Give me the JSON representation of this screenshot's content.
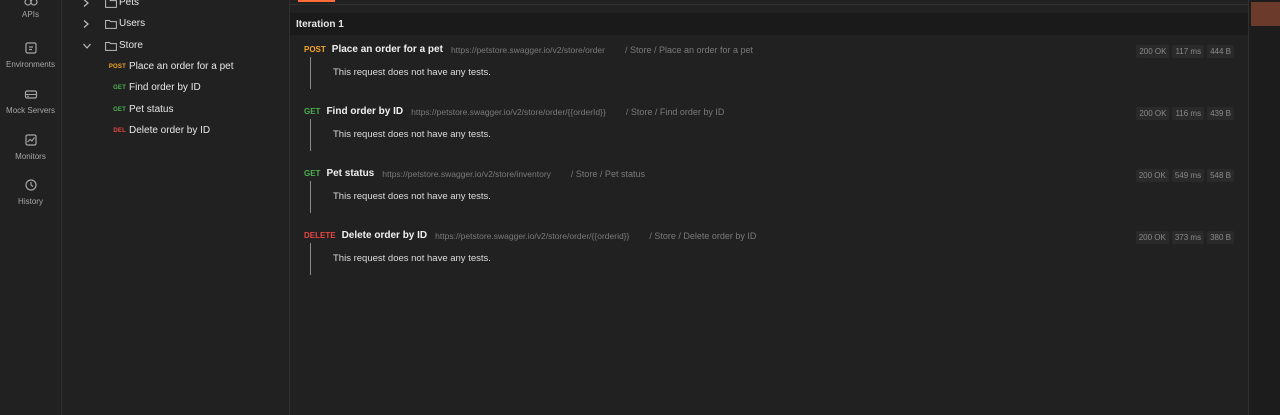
{
  "rail": {
    "items": [
      {
        "label": "APIs",
        "icon": "apis-icon"
      },
      {
        "label": "Environments",
        "icon": "environments-icon"
      },
      {
        "label": "Mock Servers",
        "icon": "mock-servers-icon"
      },
      {
        "label": "Monitors",
        "icon": "monitors-icon"
      },
      {
        "label": "History",
        "icon": "history-icon"
      }
    ]
  },
  "tree": {
    "folders": [
      {
        "name": "Pets",
        "expanded": false
      },
      {
        "name": "Users",
        "expanded": false
      },
      {
        "name": "Store",
        "expanded": true
      }
    ],
    "requests": [
      {
        "method": "POST",
        "name": "Place an order for a pet"
      },
      {
        "method": "GET",
        "name": "Find order by ID"
      },
      {
        "method": "GET",
        "name": "Pet status"
      },
      {
        "method": "DEL",
        "name": "Delete order by ID"
      }
    ]
  },
  "main": {
    "iteration_title": "Iteration 1",
    "results": [
      {
        "method": "POST",
        "name": "Place an order for a pet",
        "url": "https://petstore.swagger.io/v2/store/order",
        "path": "/ Store / Place an order for a pet",
        "status": "200 OK",
        "time": "117 ms",
        "size": "444 B",
        "message": "This request does not have any tests."
      },
      {
        "method": "GET",
        "name": "Find order by ID",
        "url": "https://petstore.swagger.io/v2/store/order/{{orderId}}",
        "path": "/ Store / Find order by ID",
        "status": "200 OK",
        "time": "116 ms",
        "size": "439 B",
        "message": "This request does not have any tests."
      },
      {
        "method": "GET",
        "name": "Pet status",
        "url": "https://petstore.swagger.io/v2/store/inventory",
        "path": "/ Store / Pet status",
        "status": "200 OK",
        "time": "549 ms",
        "size": "548 B",
        "message": "This request does not have any tests."
      },
      {
        "method": "DELETE",
        "name": "Delete order by ID",
        "url": "https://petstore.swagger.io/v2/store/order/{{orderid}}",
        "path": "/ Store / Delete order by ID",
        "status": "200 OK",
        "time": "373 ms",
        "size": "380 B",
        "message": "This request does not have any tests."
      }
    ]
  },
  "colors": {
    "get": "#4caf50",
    "post": "#f5a623",
    "delete": "#e5473f",
    "accent": "#ff6c37"
  }
}
